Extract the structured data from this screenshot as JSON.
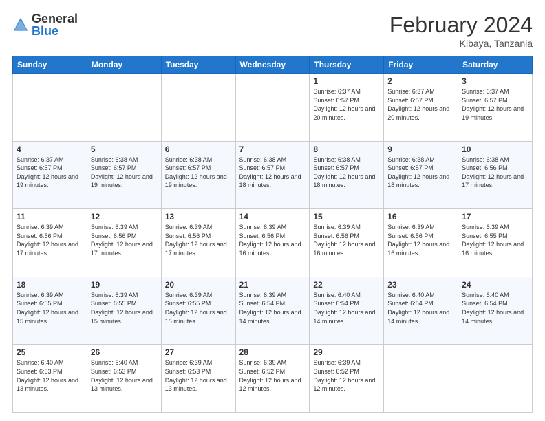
{
  "header": {
    "logo_general": "General",
    "logo_blue": "Blue",
    "title": "February 2024",
    "location": "Kibaya, Tanzania"
  },
  "weekdays": [
    "Sunday",
    "Monday",
    "Tuesday",
    "Wednesday",
    "Thursday",
    "Friday",
    "Saturday"
  ],
  "weeks": [
    [
      {
        "day": "",
        "sunrise": "",
        "sunset": "",
        "daylight": "",
        "empty": true
      },
      {
        "day": "",
        "sunrise": "",
        "sunset": "",
        "daylight": "",
        "empty": true
      },
      {
        "day": "",
        "sunrise": "",
        "sunset": "",
        "daylight": "",
        "empty": true
      },
      {
        "day": "",
        "sunrise": "",
        "sunset": "",
        "daylight": "",
        "empty": true
      },
      {
        "day": "1",
        "sunrise": "Sunrise: 6:37 AM",
        "sunset": "Sunset: 6:57 PM",
        "daylight": "Daylight: 12 hours and 20 minutes.",
        "empty": false
      },
      {
        "day": "2",
        "sunrise": "Sunrise: 6:37 AM",
        "sunset": "Sunset: 6:57 PM",
        "daylight": "Daylight: 12 hours and 20 minutes.",
        "empty": false
      },
      {
        "day": "3",
        "sunrise": "Sunrise: 6:37 AM",
        "sunset": "Sunset: 6:57 PM",
        "daylight": "Daylight: 12 hours and 19 minutes.",
        "empty": false
      }
    ],
    [
      {
        "day": "4",
        "sunrise": "Sunrise: 6:37 AM",
        "sunset": "Sunset: 6:57 PM",
        "daylight": "Daylight: 12 hours and 19 minutes.",
        "empty": false
      },
      {
        "day": "5",
        "sunrise": "Sunrise: 6:38 AM",
        "sunset": "Sunset: 6:57 PM",
        "daylight": "Daylight: 12 hours and 19 minutes.",
        "empty": false
      },
      {
        "day": "6",
        "sunrise": "Sunrise: 6:38 AM",
        "sunset": "Sunset: 6:57 PM",
        "daylight": "Daylight: 12 hours and 19 minutes.",
        "empty": false
      },
      {
        "day": "7",
        "sunrise": "Sunrise: 6:38 AM",
        "sunset": "Sunset: 6:57 PM",
        "daylight": "Daylight: 12 hours and 18 minutes.",
        "empty": false
      },
      {
        "day": "8",
        "sunrise": "Sunrise: 6:38 AM",
        "sunset": "Sunset: 6:57 PM",
        "daylight": "Daylight: 12 hours and 18 minutes.",
        "empty": false
      },
      {
        "day": "9",
        "sunrise": "Sunrise: 6:38 AM",
        "sunset": "Sunset: 6:57 PM",
        "daylight": "Daylight: 12 hours and 18 minutes.",
        "empty": false
      },
      {
        "day": "10",
        "sunrise": "Sunrise: 6:38 AM",
        "sunset": "Sunset: 6:56 PM",
        "daylight": "Daylight: 12 hours and 17 minutes.",
        "empty": false
      }
    ],
    [
      {
        "day": "11",
        "sunrise": "Sunrise: 6:39 AM",
        "sunset": "Sunset: 6:56 PM",
        "daylight": "Daylight: 12 hours and 17 minutes.",
        "empty": false
      },
      {
        "day": "12",
        "sunrise": "Sunrise: 6:39 AM",
        "sunset": "Sunset: 6:56 PM",
        "daylight": "Daylight: 12 hours and 17 minutes.",
        "empty": false
      },
      {
        "day": "13",
        "sunrise": "Sunrise: 6:39 AM",
        "sunset": "Sunset: 6:56 PM",
        "daylight": "Daylight: 12 hours and 17 minutes.",
        "empty": false
      },
      {
        "day": "14",
        "sunrise": "Sunrise: 6:39 AM",
        "sunset": "Sunset: 6:56 PM",
        "daylight": "Daylight: 12 hours and 16 minutes.",
        "empty": false
      },
      {
        "day": "15",
        "sunrise": "Sunrise: 6:39 AM",
        "sunset": "Sunset: 6:56 PM",
        "daylight": "Daylight: 12 hours and 16 minutes.",
        "empty": false
      },
      {
        "day": "16",
        "sunrise": "Sunrise: 6:39 AM",
        "sunset": "Sunset: 6:56 PM",
        "daylight": "Daylight: 12 hours and 16 minutes.",
        "empty": false
      },
      {
        "day": "17",
        "sunrise": "Sunrise: 6:39 AM",
        "sunset": "Sunset: 6:55 PM",
        "daylight": "Daylight: 12 hours and 16 minutes.",
        "empty": false
      }
    ],
    [
      {
        "day": "18",
        "sunrise": "Sunrise: 6:39 AM",
        "sunset": "Sunset: 6:55 PM",
        "daylight": "Daylight: 12 hours and 15 minutes.",
        "empty": false
      },
      {
        "day": "19",
        "sunrise": "Sunrise: 6:39 AM",
        "sunset": "Sunset: 6:55 PM",
        "daylight": "Daylight: 12 hours and 15 minutes.",
        "empty": false
      },
      {
        "day": "20",
        "sunrise": "Sunrise: 6:39 AM",
        "sunset": "Sunset: 6:55 PM",
        "daylight": "Daylight: 12 hours and 15 minutes.",
        "empty": false
      },
      {
        "day": "21",
        "sunrise": "Sunrise: 6:39 AM",
        "sunset": "Sunset: 6:54 PM",
        "daylight": "Daylight: 12 hours and 14 minutes.",
        "empty": false
      },
      {
        "day": "22",
        "sunrise": "Sunrise: 6:40 AM",
        "sunset": "Sunset: 6:54 PM",
        "daylight": "Daylight: 12 hours and 14 minutes.",
        "empty": false
      },
      {
        "day": "23",
        "sunrise": "Sunrise: 6:40 AM",
        "sunset": "Sunset: 6:54 PM",
        "daylight": "Daylight: 12 hours and 14 minutes.",
        "empty": false
      },
      {
        "day": "24",
        "sunrise": "Sunrise: 6:40 AM",
        "sunset": "Sunset: 6:54 PM",
        "daylight": "Daylight: 12 hours and 14 minutes.",
        "empty": false
      }
    ],
    [
      {
        "day": "25",
        "sunrise": "Sunrise: 6:40 AM",
        "sunset": "Sunset: 6:53 PM",
        "daylight": "Daylight: 12 hours and 13 minutes.",
        "empty": false
      },
      {
        "day": "26",
        "sunrise": "Sunrise: 6:40 AM",
        "sunset": "Sunset: 6:53 PM",
        "daylight": "Daylight: 12 hours and 13 minutes.",
        "empty": false
      },
      {
        "day": "27",
        "sunrise": "Sunrise: 6:39 AM",
        "sunset": "Sunset: 6:53 PM",
        "daylight": "Daylight: 12 hours and 13 minutes.",
        "empty": false
      },
      {
        "day": "28",
        "sunrise": "Sunrise: 6:39 AM",
        "sunset": "Sunset: 6:52 PM",
        "daylight": "Daylight: 12 hours and 12 minutes.",
        "empty": false
      },
      {
        "day": "29",
        "sunrise": "Sunrise: 6:39 AM",
        "sunset": "Sunset: 6:52 PM",
        "daylight": "Daylight: 12 hours and 12 minutes.",
        "empty": false
      },
      {
        "day": "",
        "sunrise": "",
        "sunset": "",
        "daylight": "",
        "empty": true
      },
      {
        "day": "",
        "sunrise": "",
        "sunset": "",
        "daylight": "",
        "empty": true
      }
    ]
  ]
}
